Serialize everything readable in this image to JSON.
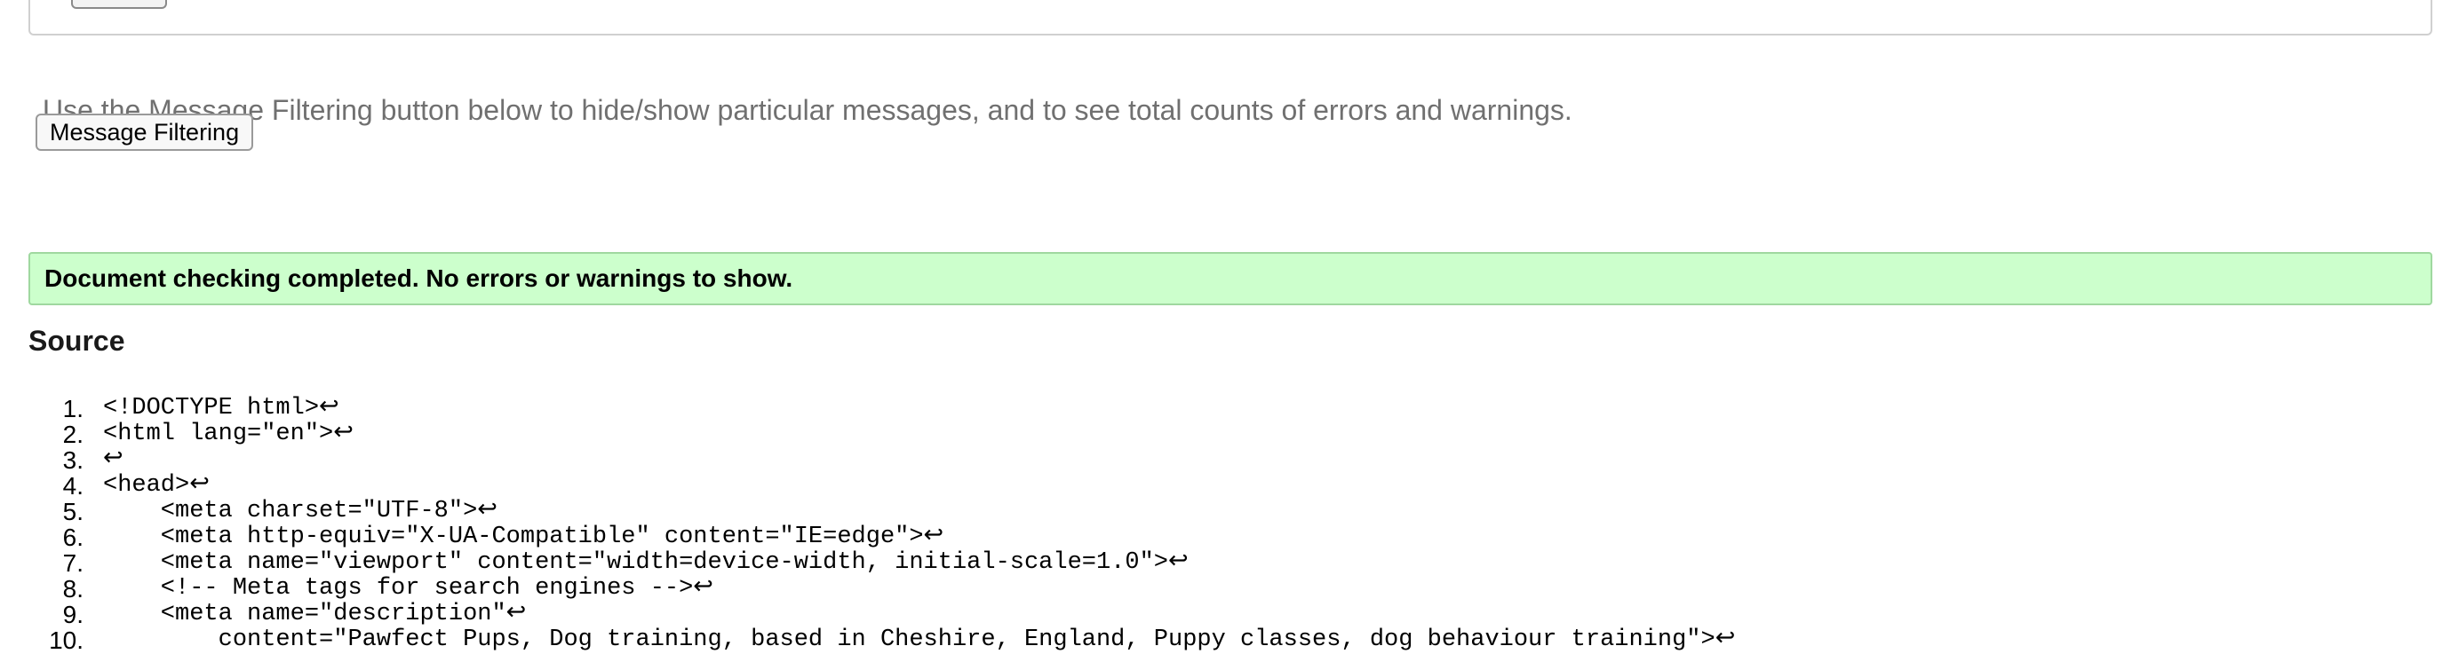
{
  "hint_text": "Use the Message Filtering button below to hide/show particular messages, and to see total counts of errors and warnings.",
  "filter_button_label": "Message Filtering",
  "result_message": "Document checking completed. No errors or warnings to show.",
  "source_heading": "Source",
  "source_lines": [
    {
      "number": "1.",
      "code": "<!DOCTYPE html>↩"
    },
    {
      "number": "2.",
      "code": "<html lang=\"en\">↩"
    },
    {
      "number": "3.",
      "code": "↩"
    },
    {
      "number": "4.",
      "code": "<head>↩"
    },
    {
      "number": "5.",
      "code": "    <meta charset=\"UTF-8\">↩"
    },
    {
      "number": "6.",
      "code": "    <meta http-equiv=\"X-UA-Compatible\" content=\"IE=edge\">↩"
    },
    {
      "number": "7.",
      "code": "    <meta name=\"viewport\" content=\"width=device-width, initial-scale=1.0\">↩"
    },
    {
      "number": "8.",
      "code": "    <!-- Meta tags for search engines -->↩"
    },
    {
      "number": "9.",
      "code": "    <meta name=\"description\"↩"
    },
    {
      "number": "10.",
      "code": "        content=\"Pawfect Pups, Dog training, based in Cheshire, England, Puppy classes, dog behaviour training\">↩"
    }
  ],
  "colors": {
    "success_background": "#ccffcc",
    "hint_text": "#707070"
  }
}
